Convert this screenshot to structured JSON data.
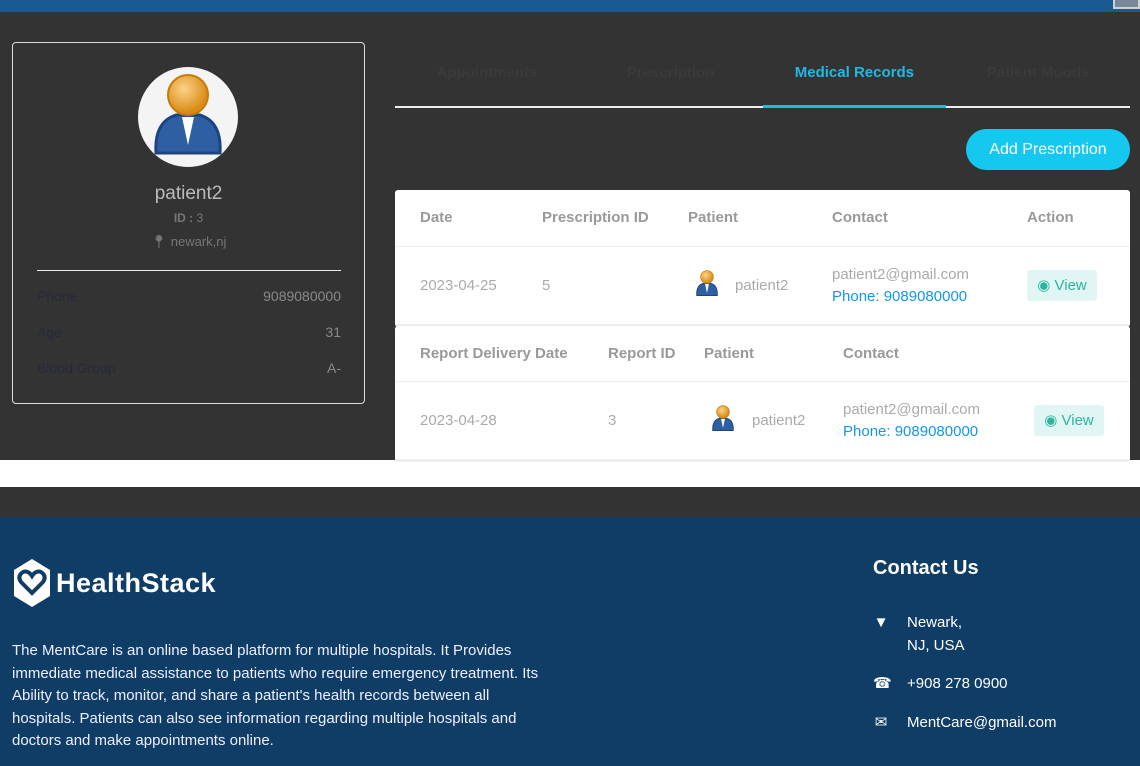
{
  "profile": {
    "name": "patient2",
    "id_label": "ID :",
    "id": "3",
    "location": "newark,nj",
    "rows": [
      {
        "label": "Phone",
        "value": "9089080000"
      },
      {
        "label": "Age",
        "value": "31"
      },
      {
        "label": "Blood Group",
        "value": "A-"
      }
    ]
  },
  "tabs": [
    {
      "label": "Appointments"
    },
    {
      "label": "Prescription"
    },
    {
      "label": "Medical Records",
      "active": true
    },
    {
      "label": "Patient Moods"
    }
  ],
  "add_prescription_label": "Add Prescription",
  "prescriptions": {
    "headers": [
      "Date",
      "Prescription ID",
      "Patient",
      "Contact",
      "Action"
    ],
    "rows": [
      {
        "date": "2023-04-25",
        "id": "5",
        "patient": "patient2",
        "email": "patient2@gmail.com",
        "phone": "Phone: 9089080000",
        "action": "View"
      }
    ]
  },
  "reports": {
    "headers": [
      "Report Delivery Date",
      "Report ID",
      "Patient",
      "Contact"
    ],
    "rows": [
      {
        "date": "2023-04-28",
        "id": "3",
        "patient": "patient2",
        "email": "patient2@gmail.com",
        "phone": "Phone: 9089080000",
        "action": "View"
      }
    ]
  },
  "footer": {
    "brand": "HealthStack",
    "about": "The MentCare is an online based platform for multiple hospitals. It Provides immediate medical assistance to patients who require emergency treatment. Its Ability to track, monitor, and share a patient's health records between all hospitals. Patients can also see information regarding multiple hospitals and doctors and make appointments online.",
    "contact_title": "Contact Us",
    "address_line1": "Newark,",
    "address_line2": "NJ, USA",
    "phone": "+908 278 0900",
    "email": "MentCare@gmail.com"
  },
  "colors": {
    "accent": "#21b8e6",
    "footer_bg": "#0f3d66",
    "button": "#14c8ef",
    "view_text": "#2bb5a0"
  }
}
